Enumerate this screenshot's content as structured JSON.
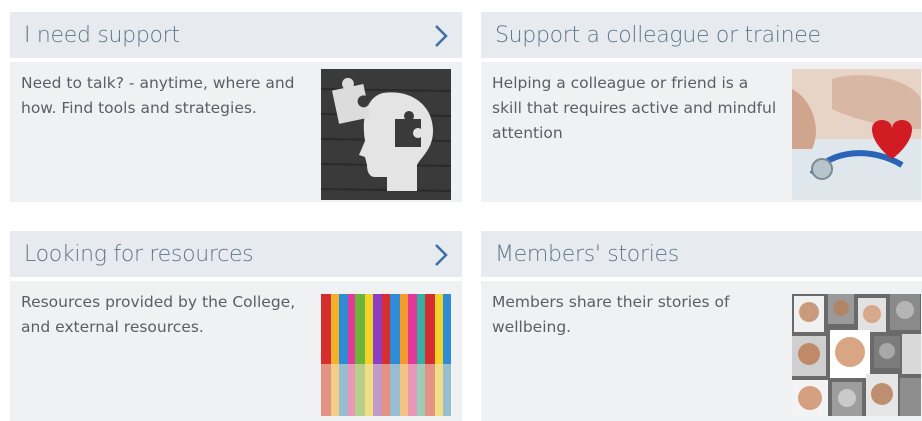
{
  "cards": [
    {
      "title": "I need support",
      "description": "Need to talk? - anytime, where and how. Find tools and strategies.",
      "image": "puzzle-head-image",
      "chevron": "chevron-right-icon"
    },
    {
      "title": "Support a colleague or trainee",
      "description": "Helping a colleague or friend is a skill that requires active and mindful attention",
      "image": "heart-stethoscope-image",
      "chevron": "chevron-right-icon"
    },
    {
      "title": "Looking for resources",
      "description": " Resources provided by the College, and external resources.",
      "image": "colored-file-folders-image",
      "chevron": "chevron-right-icon"
    },
    {
      "title": "Members' stories",
      "description": "Members share their stories of wellbeing.",
      "image": "faces-collage-image",
      "chevron": "chevron-right-icon"
    }
  ],
  "colors": {
    "header_bg": "#e7ebef",
    "body_bg": "#f0f1f3",
    "title_text": "#5d7689",
    "chevron": "#3f6fa8"
  }
}
